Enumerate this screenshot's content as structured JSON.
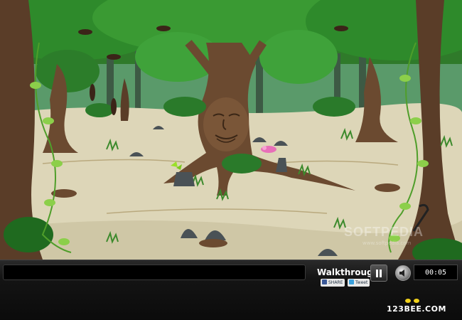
{
  "hud": {
    "message": "",
    "walkthrough_label": "Walkthrough",
    "timer": "00:05",
    "share_facebook": "SHARE",
    "share_twitter": "Tweet",
    "brand": "123BEE.COM"
  },
  "watermark": {
    "text": "SOFTPEDIA",
    "url": "www.softpedia.com"
  },
  "icons": {
    "pause": "pause-icon",
    "sound": "speaker-icon",
    "facebook": "facebook-icon",
    "twitter": "twitter-icon",
    "bee": "bee-icon"
  },
  "colors": {
    "sky_canopy": "#2f7a2a",
    "ground": "#ddd6b8",
    "trunk": "#6b4a30",
    "hud_bg": "#111111"
  }
}
